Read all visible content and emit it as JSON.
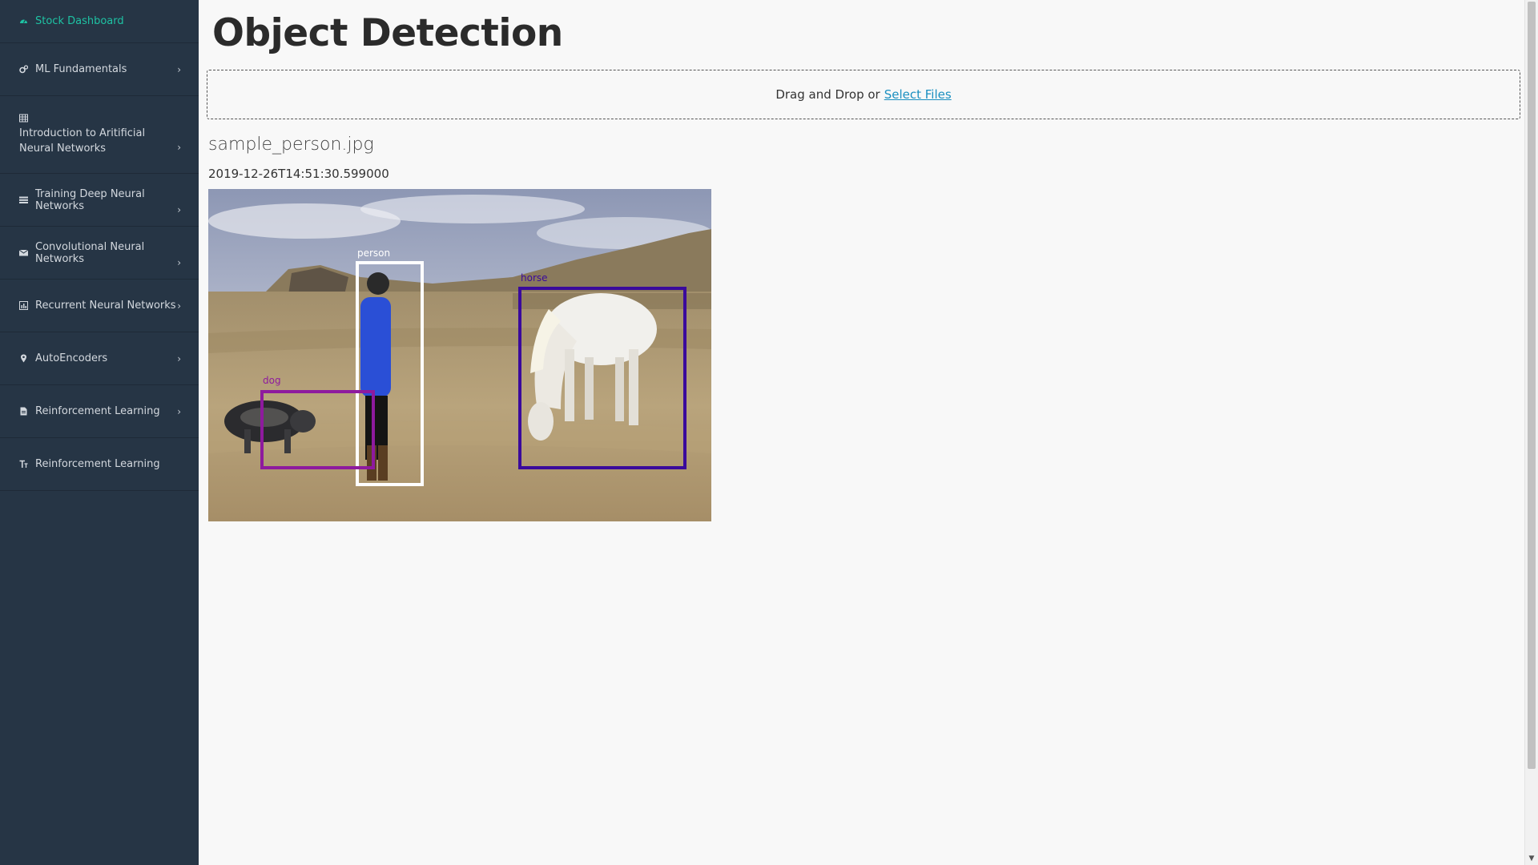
{
  "sidebar": {
    "items": [
      {
        "label": "Stock Dashboard",
        "icon": "dashboard-icon",
        "active": true
      },
      {
        "label": "ML Fundamentals",
        "icon": "gears-icon"
      },
      {
        "label": "Introduction to Aritificial Neural Networks",
        "icon": "table-icon"
      },
      {
        "label": "Training Deep Neural Networks",
        "icon": "list-icon"
      },
      {
        "label": "Convolutional Neural Networks",
        "icon": "envelope-icon"
      },
      {
        "label": "Recurrent Neural Networks",
        "icon": "bar-chart-icon"
      },
      {
        "label": "AutoEncoders",
        "icon": "map-marker-icon"
      },
      {
        "label": "Reinforcement Learning",
        "icon": "file-icon"
      },
      {
        "label": "Reinforcement Learning",
        "icon": "text-size-icon"
      }
    ],
    "chevron": "›"
  },
  "main": {
    "title": "Object Detection",
    "upload": {
      "prompt": "Drag and Drop or",
      "link": "Select Files"
    },
    "filename": "sample_person.jpg",
    "timestamp": "2019-12-26T14:51:30.599000",
    "detections": [
      {
        "label": "person",
        "color": "#ffffff"
      },
      {
        "label": "horse",
        "color": "#3a0a9c"
      },
      {
        "label": "dog",
        "color": "#8e1a9e"
      }
    ]
  },
  "colors": {
    "sidebar_bg": "#263545",
    "accent": "#1ec2a3",
    "link": "#1a8fc0"
  }
}
